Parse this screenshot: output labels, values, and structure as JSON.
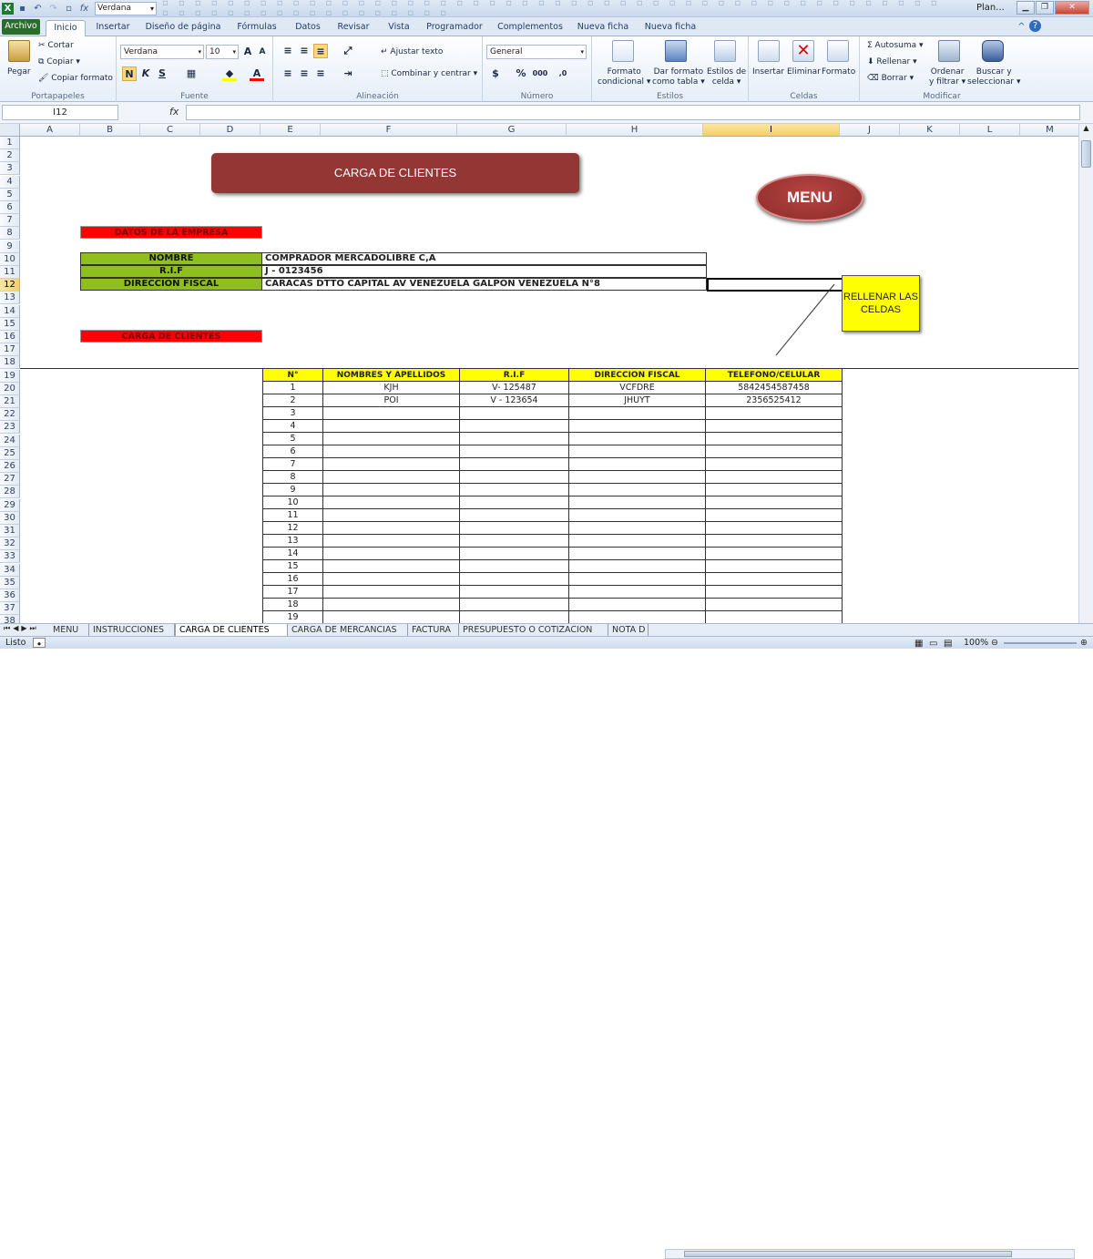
{
  "qat": {
    "font_name": "Verdana",
    "window_title": "Plan..."
  },
  "ribbon_tabs": [
    "Archivo",
    "Inicio",
    "Insertar",
    "Diseño de página",
    "Fórmulas",
    "Datos",
    "Revisar",
    "Programador",
    "Complementos",
    "Nueva ficha",
    "Nueva ficha"
  ],
  "ribbon": {
    "paste": "Pegar",
    "cut": "Cortar",
    "copy": "Copiar ▾",
    "copy_format": "Copiar formato",
    "clipboard_group": "Portapapeles",
    "font_name": "Verdana",
    "font_size": "10",
    "bold": "N",
    "italic": "K",
    "underline": "S",
    "font_group": "Fuente",
    "wrap_text": "Ajustar texto",
    "merge_center": "Combinar y centrar ▾",
    "alignment_group": "Alineación",
    "number_format": "General",
    "percent": "%",
    "thousands": "000",
    "number_group": "Número",
    "cond_format_1": "Formato",
    "cond_format_2": "condicional ▾",
    "table_format_1": "Dar formato",
    "table_format_2": "como tabla ▾",
    "cell_styles_1": "Estilos de",
    "cell_styles_2": "celda ▾",
    "styles_group": "Estilos",
    "insert": "Insertar",
    "delete": "Eliminar",
    "format": "Formato",
    "cells_group": "Celdas",
    "autosum": "Σ Autosuma ▾",
    "fill": "Rellenar ▾",
    "clear": "Borrar ▾",
    "sort_1": "Ordenar",
    "sort_2": "y filtrar ▾",
    "find_1": "Buscar y",
    "find_2": "seleccionar ▾",
    "modify_group": "Modificar"
  },
  "formula_bar": {
    "name_box": "I12",
    "fx": "fx",
    "value": ""
  },
  "columns": [
    "A",
    "B",
    "C",
    "D",
    "E",
    "F",
    "G",
    "H",
    "I",
    "J",
    "K",
    "L",
    "M"
  ],
  "selected_column": "I",
  "rows": [
    "1",
    "2",
    "3",
    "4",
    "5",
    "6",
    "7",
    "8",
    "9",
    "10",
    "11",
    "12",
    "13",
    "14",
    "15",
    "16",
    "17",
    "18",
    "19",
    "20",
    "21",
    "22",
    "23",
    "24",
    "25",
    "26",
    "27",
    "28",
    "29",
    "30",
    "31",
    "32",
    "33",
    "34",
    "35",
    "36",
    "37",
    "38"
  ],
  "selected_row": "12",
  "sheet": {
    "title": "CARGA DE CLIENTES",
    "menu_button": "MENU",
    "company_header": "DATOS DE LA EMPRESA",
    "nombre_label": "NOMBRE",
    "nombre_value": "COMPRADOR MERCADOLIBRE C,A",
    "rif_label": "R.I.F",
    "rif_value": "J - 0123456",
    "direccion_label": "DIRECCION FISCAL",
    "direccion_value": "CARACAS DTTO CAPITAL AV VENEZUELA GALPON VENEZUELA N°8",
    "callout": "RELLENAR LAS CELDAS",
    "clients_header": "CARGA DE CLIENTES"
  },
  "clients_table": {
    "headers": [
      "N°",
      "NOMBRES  Y APELLIDOS",
      "R.I.F",
      "DIRECCION FISCAL",
      "TELEFONO/CELULAR"
    ],
    "rows": [
      [
        "1",
        "KJH",
        "V- 125487",
        "VCFDRE",
        "5842454587458"
      ],
      [
        "2",
        "POI",
        "V - 123654",
        "JHUYT",
        "2356525412"
      ],
      [
        "3",
        "",
        "",
        "",
        ""
      ],
      [
        "4",
        "",
        "",
        "",
        ""
      ],
      [
        "5",
        "",
        "",
        "",
        ""
      ],
      [
        "6",
        "",
        "",
        "",
        ""
      ],
      [
        "7",
        "",
        "",
        "",
        ""
      ],
      [
        "8",
        "",
        "",
        "",
        ""
      ],
      [
        "9",
        "",
        "",
        "",
        ""
      ],
      [
        "10",
        "",
        "",
        "",
        ""
      ],
      [
        "11",
        "",
        "",
        "",
        ""
      ],
      [
        "12",
        "",
        "",
        "",
        ""
      ],
      [
        "13",
        "",
        "",
        "",
        ""
      ],
      [
        "14",
        "",
        "",
        "",
        ""
      ],
      [
        "15",
        "",
        "",
        "",
        ""
      ],
      [
        "16",
        "",
        "",
        "",
        ""
      ],
      [
        "17",
        "",
        "",
        "",
        ""
      ],
      [
        "18",
        "",
        "",
        "",
        ""
      ],
      [
        "19",
        "",
        "",
        "",
        ""
      ]
    ]
  },
  "sheet_tabs": [
    "MENU",
    "INSTRUCCIONES",
    "CARGA DE CLIENTES",
    "CARGA DE MERCANCIAS",
    "FACTURA",
    "PRESUPUESTO O COTIZACION",
    "NOTA D"
  ],
  "active_sheet": "CARGA DE CLIENTES",
  "status": {
    "ready": "Listo",
    "zoom": "100%"
  }
}
